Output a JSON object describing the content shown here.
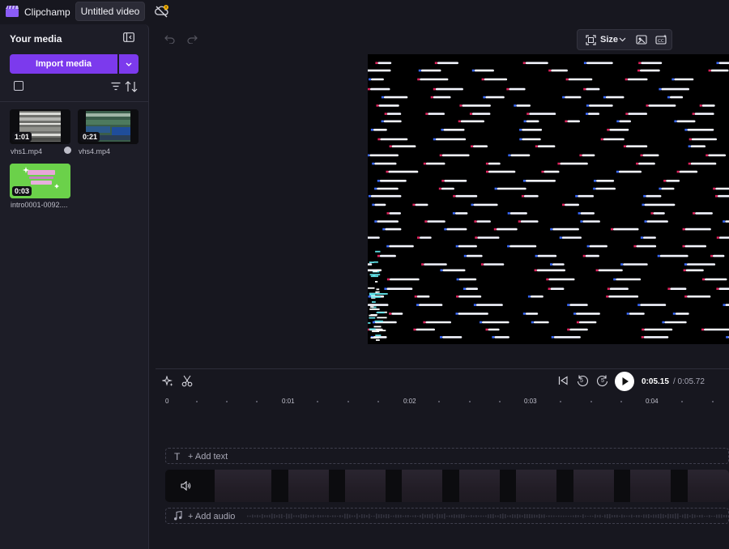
{
  "app": {
    "name": "Clipchamp",
    "project_title": "Untitled video"
  },
  "media_panel": {
    "title": "Your media",
    "import_label": "Import media",
    "items": [
      {
        "duration": "1:01",
        "filename": "vhs1.mp4"
      },
      {
        "duration": "0:21",
        "filename": "vhs4.mp4"
      },
      {
        "duration": "0:03",
        "filename": "intro0001-0092...."
      }
    ]
  },
  "stage": {
    "size_label": "Size"
  },
  "timeline": {
    "current_time": "0:05.15",
    "total_time": "/ 0:05.72",
    "rewind_seconds": "5",
    "forward_seconds": "5",
    "ruler_labels": [
      "0",
      "0:01",
      "0:02",
      "0:03",
      "0:04"
    ],
    "add_text_label": "+ Add text",
    "add_audio_label": "+ Add audio"
  },
  "colors": {
    "accent": "#7c3aed",
    "background": "#17171f",
    "panel": "#1d1d27",
    "thumb_green": "#6bd14a"
  },
  "icons": [
    "clipchamp-logo",
    "cloud-sync-off-icon",
    "collapse-panel-icon",
    "chevron-down-icon",
    "filter-icon",
    "sort-icon",
    "check-icon",
    "undo-icon",
    "redo-icon",
    "resize-icon",
    "background-icon",
    "captions-icon",
    "magic-icon",
    "scissors-icon",
    "skip-to-start-icon",
    "rewind-icon",
    "forward-icon",
    "play-icon",
    "text-icon",
    "volume-icon",
    "music-note-icon"
  ]
}
